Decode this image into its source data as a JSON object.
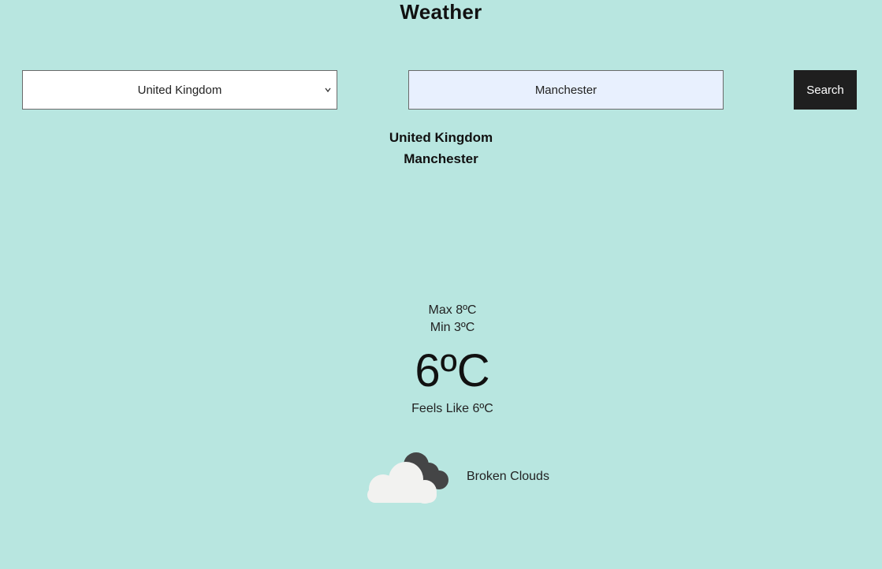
{
  "header": {
    "title": "Weather"
  },
  "search": {
    "country_selected": "United Kingdom",
    "city_value": "Manchester",
    "button_label": "Search"
  },
  "location": {
    "country": "United Kingdom",
    "city": "Manchester"
  },
  "weather": {
    "max": "Max 8ºC",
    "min": "Min 3ºC",
    "temperature": "6ºC",
    "feels_like": "Feels Like 6ºC",
    "description": "Broken Clouds",
    "icon": "broken-clouds-icon"
  }
}
